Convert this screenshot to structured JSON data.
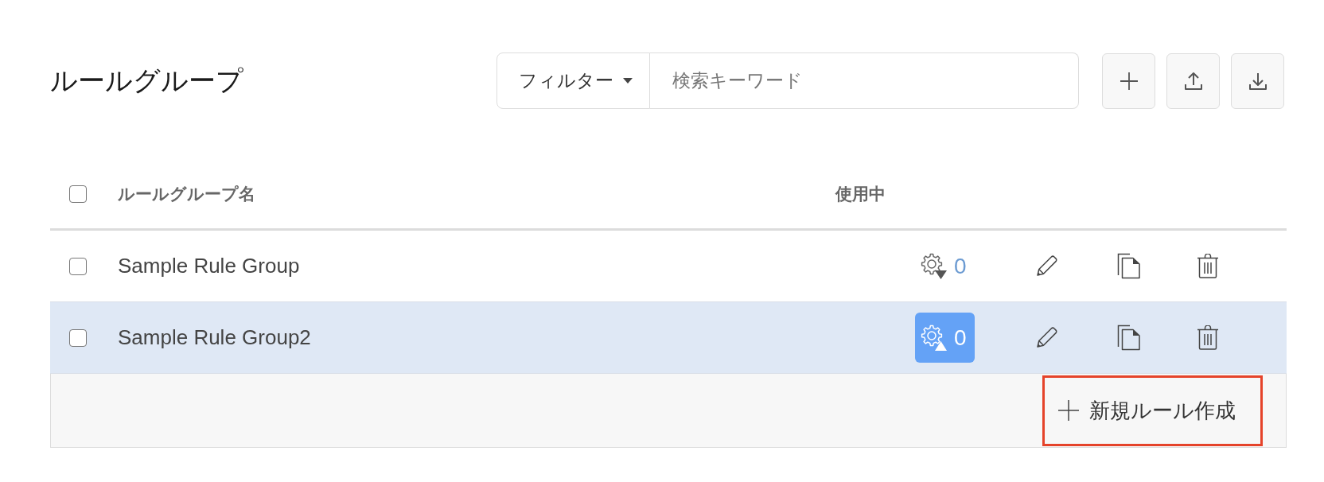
{
  "page": {
    "title": "ルールグループ"
  },
  "toolbar": {
    "filter": {
      "label": "フィルター"
    },
    "search": {
      "placeholder": "検索キーワード"
    },
    "buttons": [
      {
        "kind": "add"
      },
      {
        "kind": "upload"
      },
      {
        "kind": "download"
      }
    ]
  },
  "table": {
    "select_all": {
      "checked": false
    },
    "columns": [
      {
        "label": "ルールグループ名"
      },
      {
        "label": "使用中"
      }
    ],
    "rows": [
      {
        "checked": false,
        "name": "Sample Rule Group",
        "highlighted": false,
        "in_use": {
          "count": "0",
          "active": false
        }
      },
      {
        "checked": false,
        "name": "Sample Rule Group2",
        "highlighted": true,
        "in_use": {
          "count": "0",
          "active": true
        }
      }
    ],
    "footer": {
      "create_button": {
        "label": "新規ルール作成",
        "highlighted": true
      }
    }
  }
}
